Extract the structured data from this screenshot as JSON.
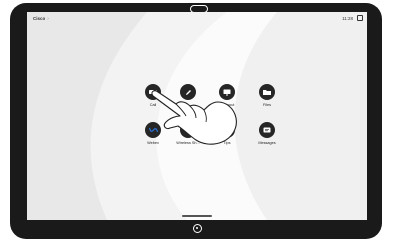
{
  "device": {
    "topbar": {
      "brand": "Cisco",
      "brand_chevron": "›",
      "time": "11:28"
    },
    "apps": [
      {
        "label": "Call",
        "icon": "video-camera-icon"
      },
      {
        "label": "",
        "icon": "pencil-icon"
      },
      {
        "label": "PC Input",
        "icon": "monitor-icon"
      },
      {
        "label": "Files",
        "icon": "folder-icon"
      },
      {
        "label": "Webex",
        "icon": "webex-icon"
      },
      {
        "label": "Wireless Sh...",
        "icon": "cast-icon"
      },
      {
        "label": "Tips",
        "icon": "lightbulb-icon"
      },
      {
        "label": "Messages",
        "icon": "message-icon"
      }
    ]
  },
  "colors": {
    "icon_bg": "#262626",
    "webex_blue": "#2b6fcf",
    "bezel": "#1a1a1a"
  }
}
